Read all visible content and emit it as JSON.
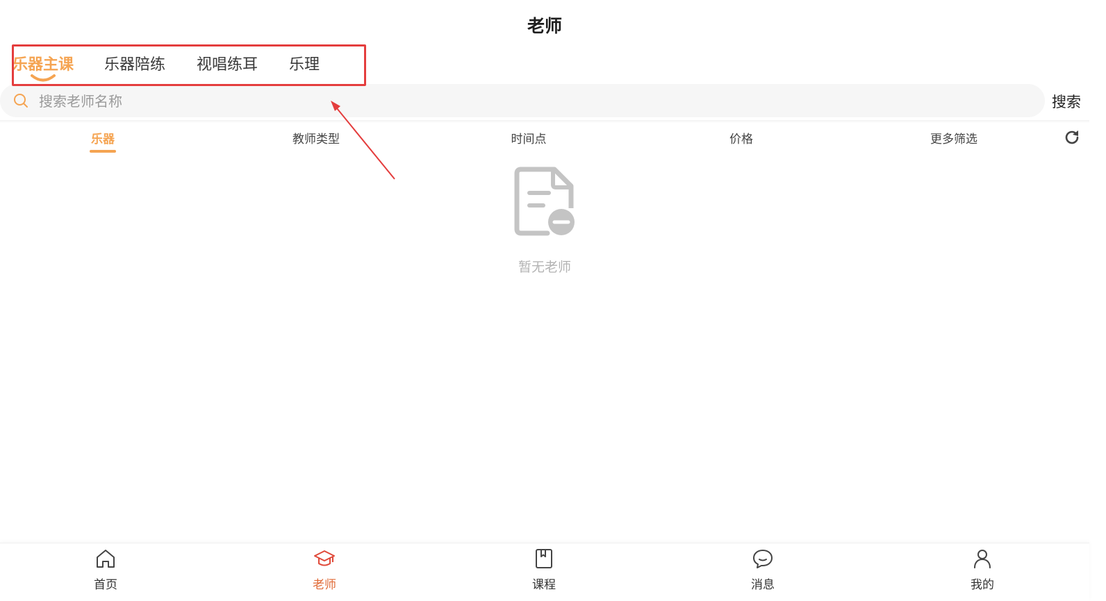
{
  "header": {
    "title": "老师"
  },
  "category_tabs": [
    {
      "label": "乐器主课",
      "active": true
    },
    {
      "label": "乐器陪练",
      "active": false
    },
    {
      "label": "视唱练耳",
      "active": false
    },
    {
      "label": "乐理",
      "active": false
    }
  ],
  "search": {
    "placeholder": "搜索老师名称",
    "value": "",
    "button_label": "搜索",
    "icon": "search-icon"
  },
  "filters": [
    {
      "label": "乐器",
      "active": true
    },
    {
      "label": "教师类型",
      "active": false
    },
    {
      "label": "时间点",
      "active": false
    },
    {
      "label": "价格",
      "active": false
    },
    {
      "label": "更多筛选",
      "active": false
    }
  ],
  "refresh_icon": "refresh-icon",
  "empty_state": {
    "text": "暂无老师",
    "icon": "empty-document-icon"
  },
  "bottom_nav": [
    {
      "label": "首页",
      "icon": "home-icon",
      "active": false
    },
    {
      "label": "老师",
      "icon": "graduation-cap-icon",
      "active": true
    },
    {
      "label": "课程",
      "icon": "book-icon",
      "active": false
    },
    {
      "label": "消息",
      "icon": "chat-bubble-icon",
      "active": false
    },
    {
      "label": "我的",
      "icon": "user-icon",
      "active": false
    }
  ],
  "colors": {
    "accent_orange": "#f5a452",
    "nav_active": "#e06a36",
    "annotation_red": "#e43d3d",
    "empty_gray": "#c4c4c4"
  }
}
